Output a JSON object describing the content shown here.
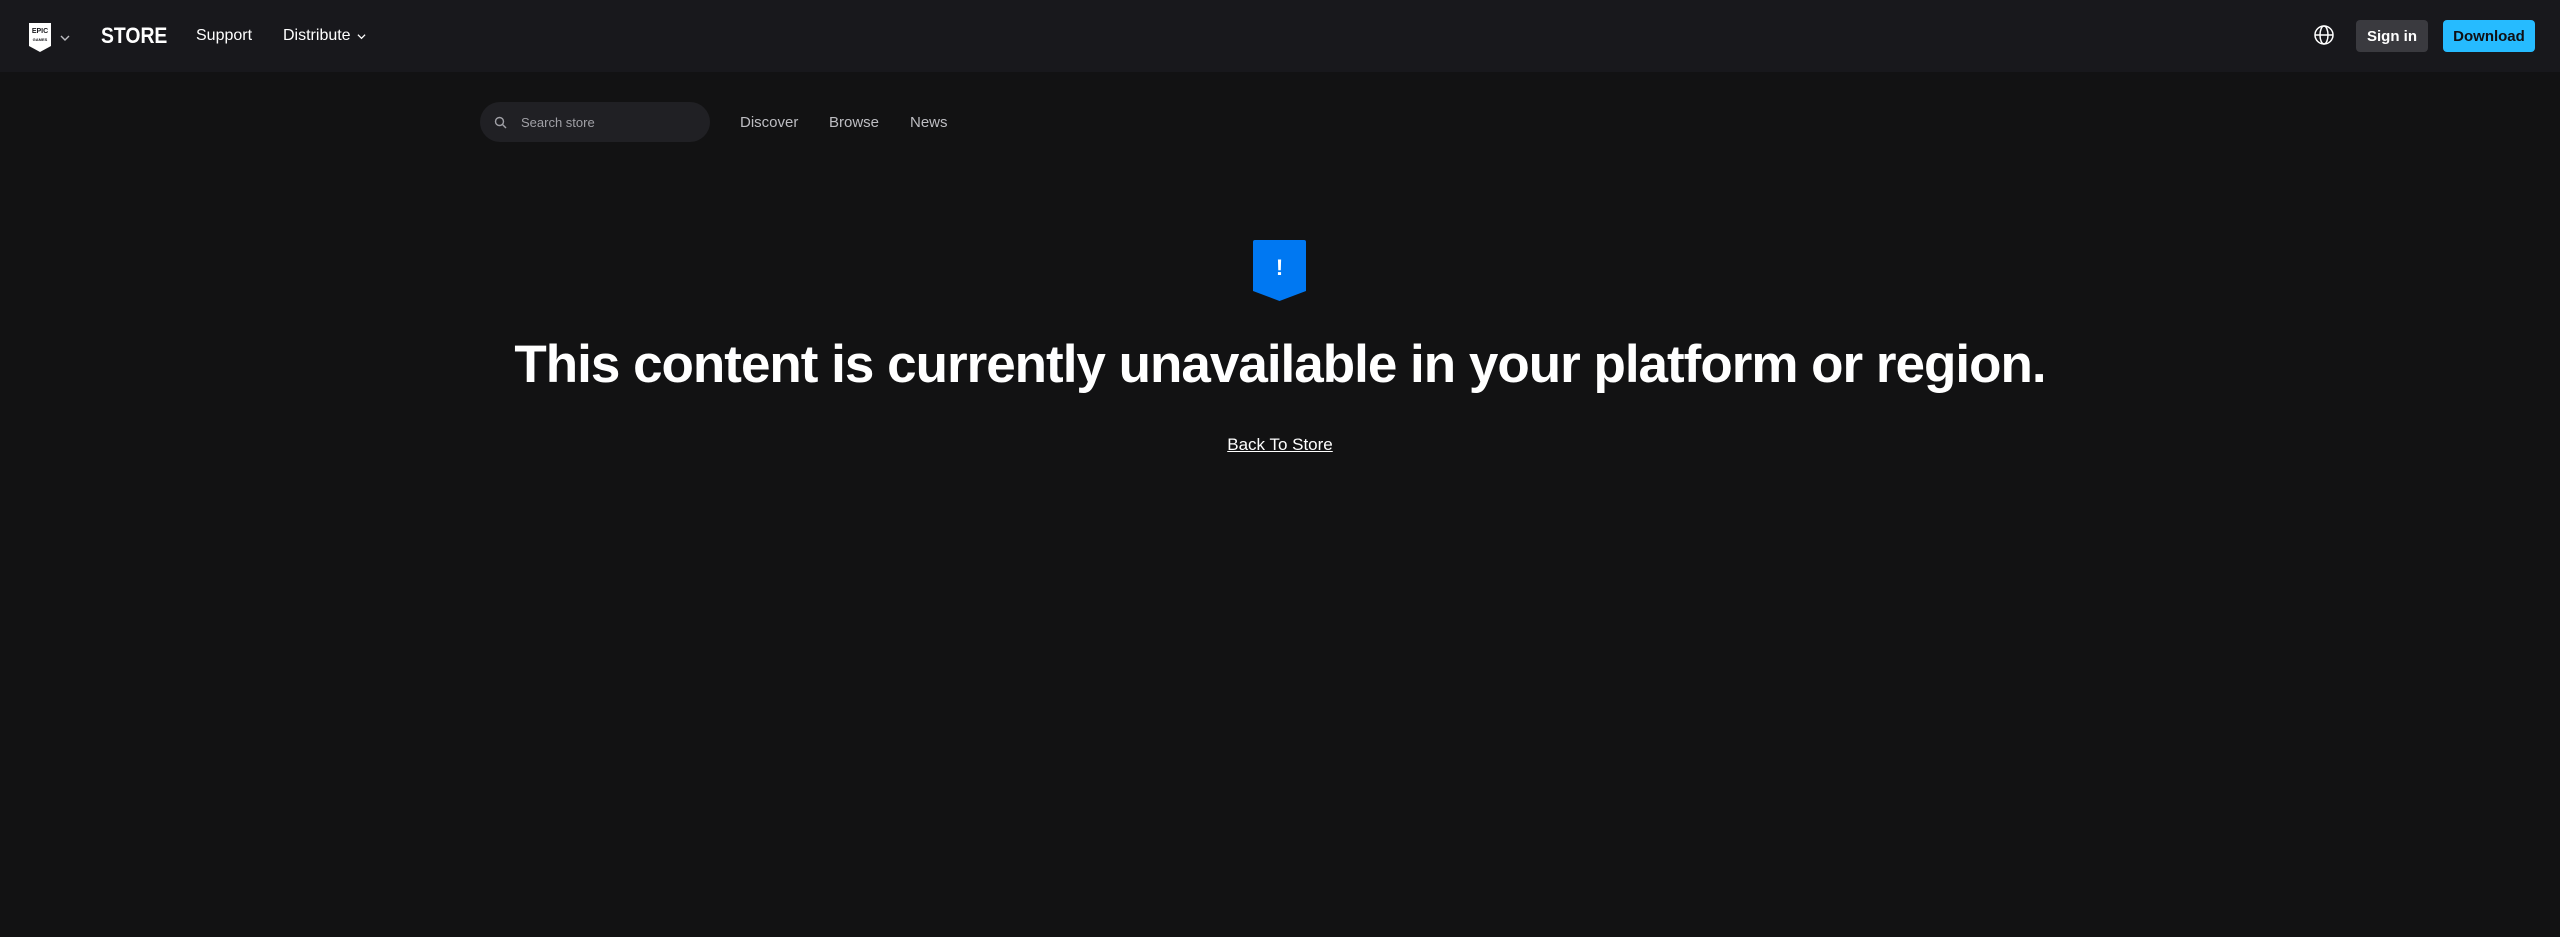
{
  "header": {
    "store_label": "STORE",
    "nav": {
      "support": "Support",
      "distribute": "Distribute"
    },
    "sign_in_label": "Sign in",
    "download_label": "Download"
  },
  "subnav": {
    "search_placeholder": "Search store",
    "links": {
      "discover": "Discover",
      "browse": "Browse",
      "news": "News"
    }
  },
  "main": {
    "alert_symbol": "!",
    "message": "This content is currently unavailable in your platform or region.",
    "back_link_label": "Back To Store"
  },
  "colors": {
    "background": "#121213",
    "topbar": "#18181c",
    "accent": "#26bbff",
    "alert_blue": "#0078f2",
    "sign_in_bg": "#3a3a3f"
  },
  "icons": {
    "logo": "epic-games-shield-icon",
    "logo_dropdown": "chevron-down-icon",
    "distribute_dropdown": "chevron-down-icon",
    "language": "globe-icon",
    "search": "search-icon",
    "alert": "exclamation-badge-icon"
  }
}
